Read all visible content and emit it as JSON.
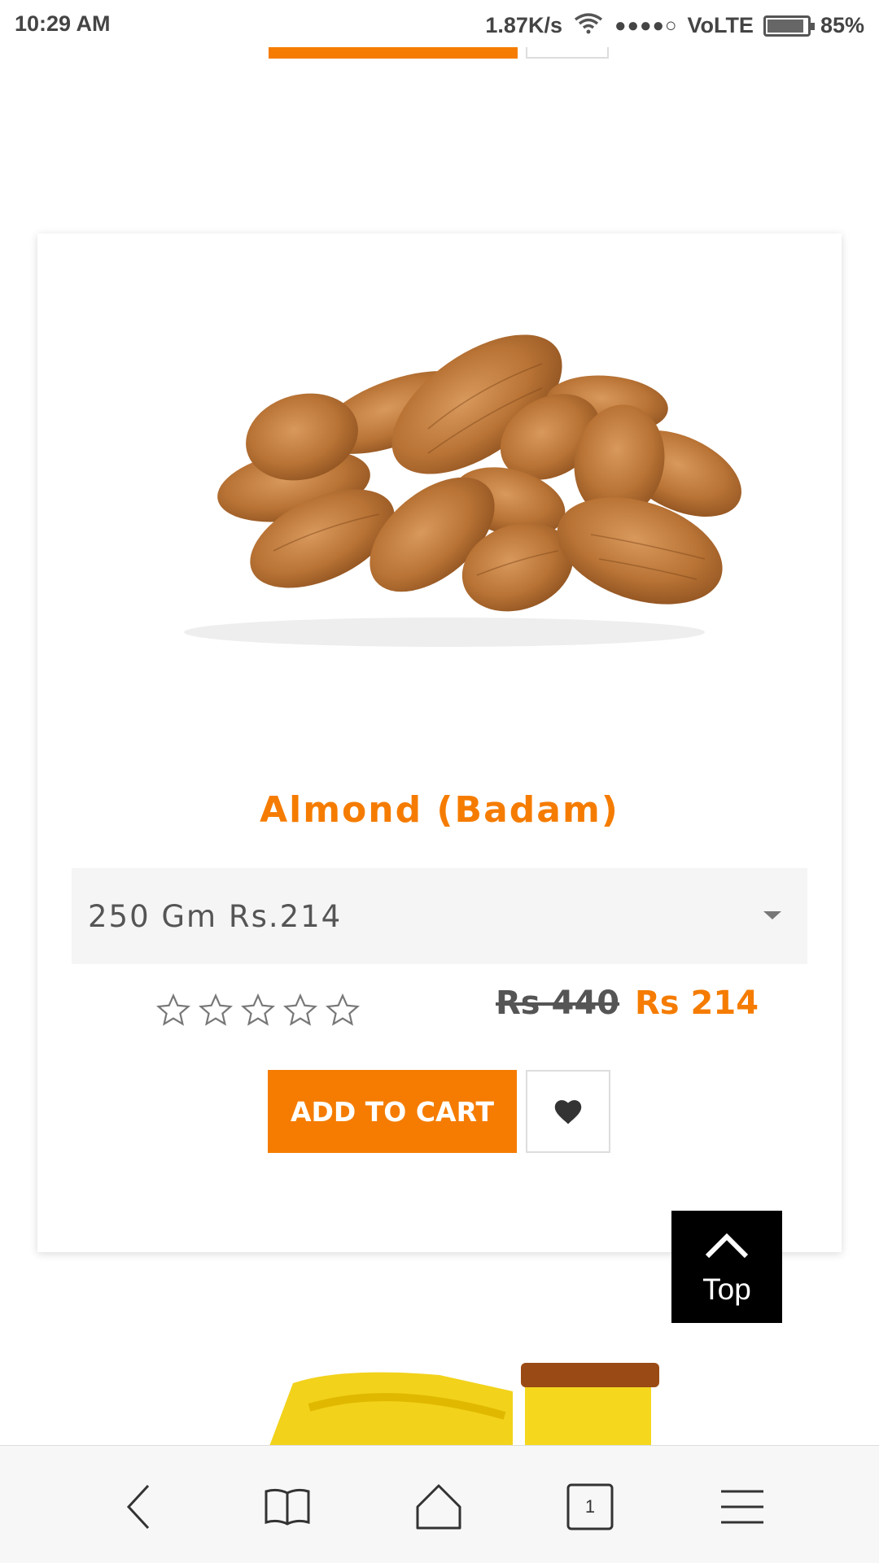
{
  "status_bar": {
    "time": "10:29 AM",
    "speed": "1.87K/s",
    "signal": "●●●●○",
    "network": "VoLTE",
    "battery": "85%"
  },
  "product": {
    "title": "Almond (Badam)",
    "variant_selected": "250 Gm Rs.214",
    "rating_stars": 0,
    "rating_max": 5,
    "price_old": "Rs 440",
    "price_new": "Rs 214",
    "add_to_cart_label": "ADD TO CART"
  },
  "top_button": {
    "label": "Top"
  },
  "browser_bar": {
    "tab_count": "1",
    "icons": [
      "back-icon",
      "bookmarks-icon",
      "home-icon",
      "tabs-icon",
      "menu-icon"
    ]
  },
  "colors": {
    "accent": "#f57c00",
    "dark": "#000000"
  }
}
